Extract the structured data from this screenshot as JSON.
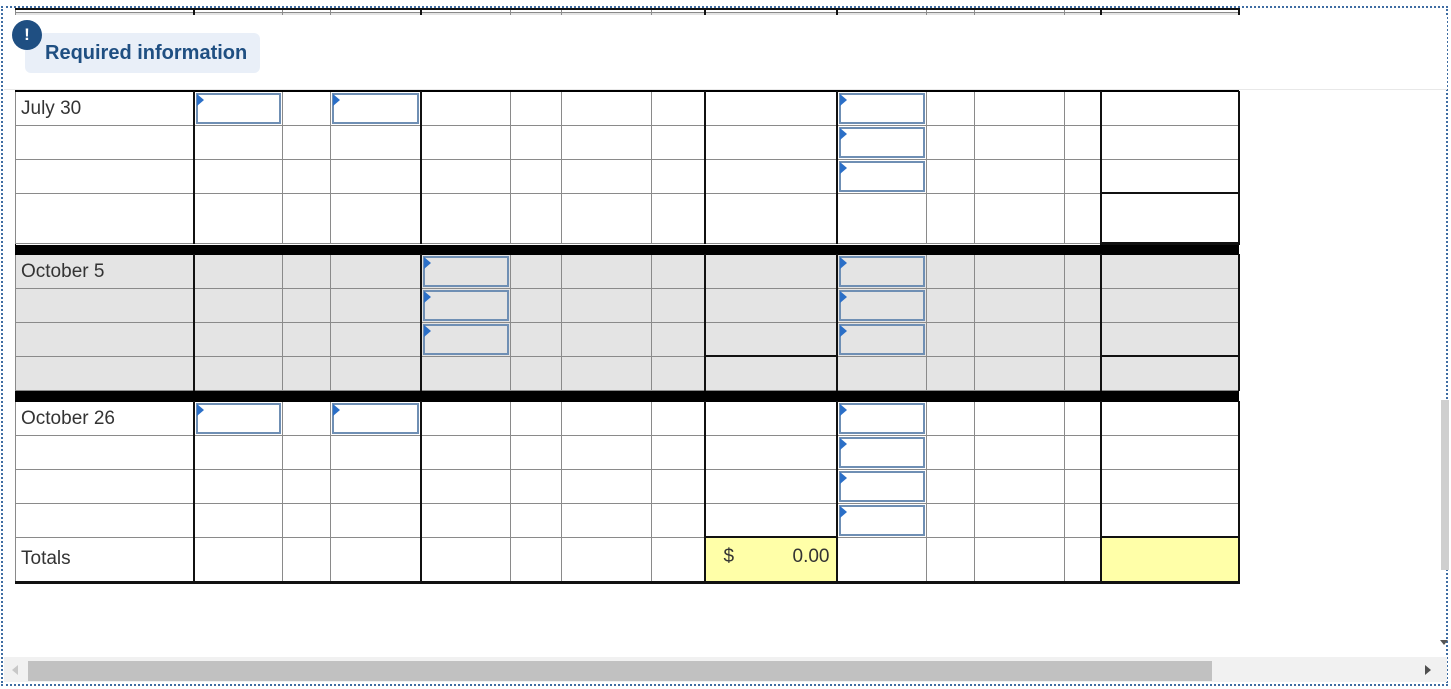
{
  "banner": {
    "icon": "exclamation-icon",
    "icon_glyph": "!",
    "label": "Required information"
  },
  "rows": {
    "july30": "July 30",
    "oct5": "October 5",
    "oct26": "October 26",
    "totals": "Totals"
  },
  "totals": {
    "currency": "$",
    "amount": "0.00"
  },
  "colors": {
    "accent": "#1f4f82",
    "highlight": "#ffffa8",
    "gray_row": "#e4e4e4"
  }
}
